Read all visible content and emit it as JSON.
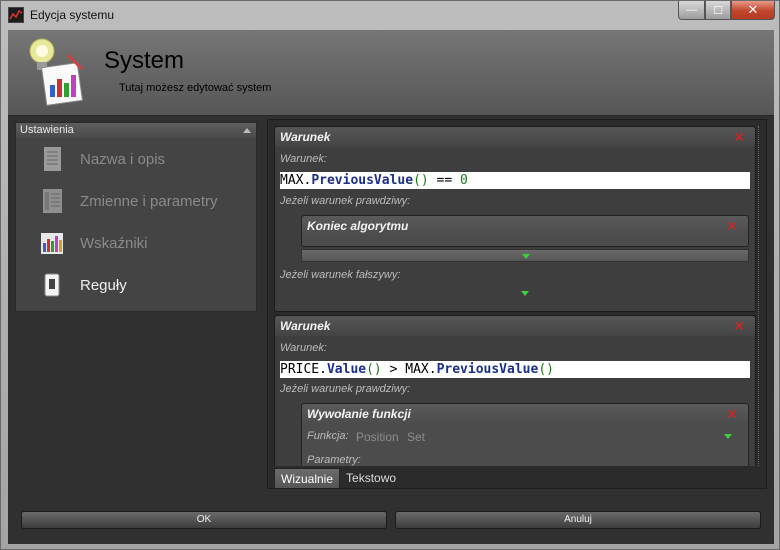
{
  "window": {
    "title": "Edycja systemu",
    "minimize": "—",
    "maximize": "☐",
    "close": "✕"
  },
  "header": {
    "title": "System",
    "subtitle": "Tutaj możesz edytować system"
  },
  "sidebar": {
    "section_title": "Ustawienia",
    "items": [
      {
        "label": "Nazwa i opis",
        "icon": "document-icon",
        "active": false
      },
      {
        "label": "Zmienne i parametry",
        "icon": "list-icon",
        "active": false
      },
      {
        "label": "Wskaźniki",
        "icon": "chart-icon",
        "active": false
      },
      {
        "label": "Reguły",
        "icon": "switch-icon",
        "active": true
      }
    ]
  },
  "rules": [
    {
      "header": "Warunek",
      "condition_label": "Warunek:",
      "condition_code": "MAX.PreviousValue() == 0",
      "true_label": "Jeżeli warunek prawdziwy:",
      "true_block": {
        "header": "Koniec algorytmu"
      },
      "false_label": "Jeżeli warunek fałszywy:"
    },
    {
      "header": "Warunek",
      "condition_label": "Warunek:",
      "condition_code": "PRICE.Value() > MAX.PreviousValue()",
      "true_label": "Jeżeli warunek prawdziwy:",
      "true_block": {
        "header": "Wywołanie funkcji",
        "function_label": "Funkcja:",
        "function_value_1": "Position",
        "function_value_2": "Set",
        "params_label": "Parametry:"
      }
    }
  ],
  "tabs": [
    {
      "label": "Wizualnie",
      "active": true
    },
    {
      "label": "Tekstowo",
      "active": false
    }
  ],
  "buttons": {
    "ok": "OK",
    "cancel": "Anuluj"
  },
  "colors": {
    "delete_icon": "#e02020",
    "expand_triangle": "#3ecf3e"
  }
}
